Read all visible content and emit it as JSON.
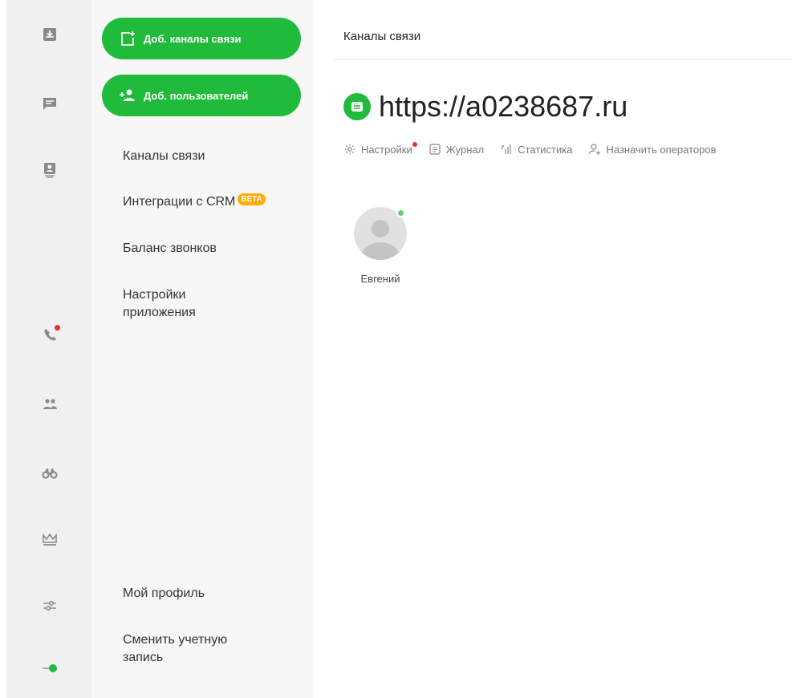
{
  "rail": {
    "icons": [
      "inbox-icon",
      "chat-icon",
      "contacts-icon",
      "phone-icon",
      "users-icon",
      "binoculars-icon",
      "crown-icon",
      "sliders-icon",
      "status-toggle-icon"
    ],
    "accent": "#21bb3b",
    "alert_color": "#e8322b"
  },
  "menu": {
    "add_channels_label": "Доб. каналы связи",
    "add_users_label": "Доб. пользователей",
    "items": [
      {
        "label": "Каналы связи"
      },
      {
        "label": "Интеграции с CRM",
        "badge": "BETA"
      },
      {
        "label": "Баланс звонков"
      },
      {
        "label": "Настройки приложения"
      }
    ],
    "bottom_items": [
      {
        "label": "Мой профиль"
      },
      {
        "label": "Сменить учетную запись"
      }
    ]
  },
  "main": {
    "breadcrumb": "Каналы связи",
    "site_title": "https://a0238687.ru",
    "actions": [
      {
        "label": "Настройки",
        "icon": "gear-icon",
        "alert": true
      },
      {
        "label": "Журнал",
        "icon": "journal-icon"
      },
      {
        "label": "Статистика",
        "icon": "statistics-icon"
      },
      {
        "label": "Назначить операторов",
        "icon": "assign-user-icon"
      }
    ],
    "operators": [
      {
        "name": "Евгений",
        "online": true
      }
    ]
  }
}
